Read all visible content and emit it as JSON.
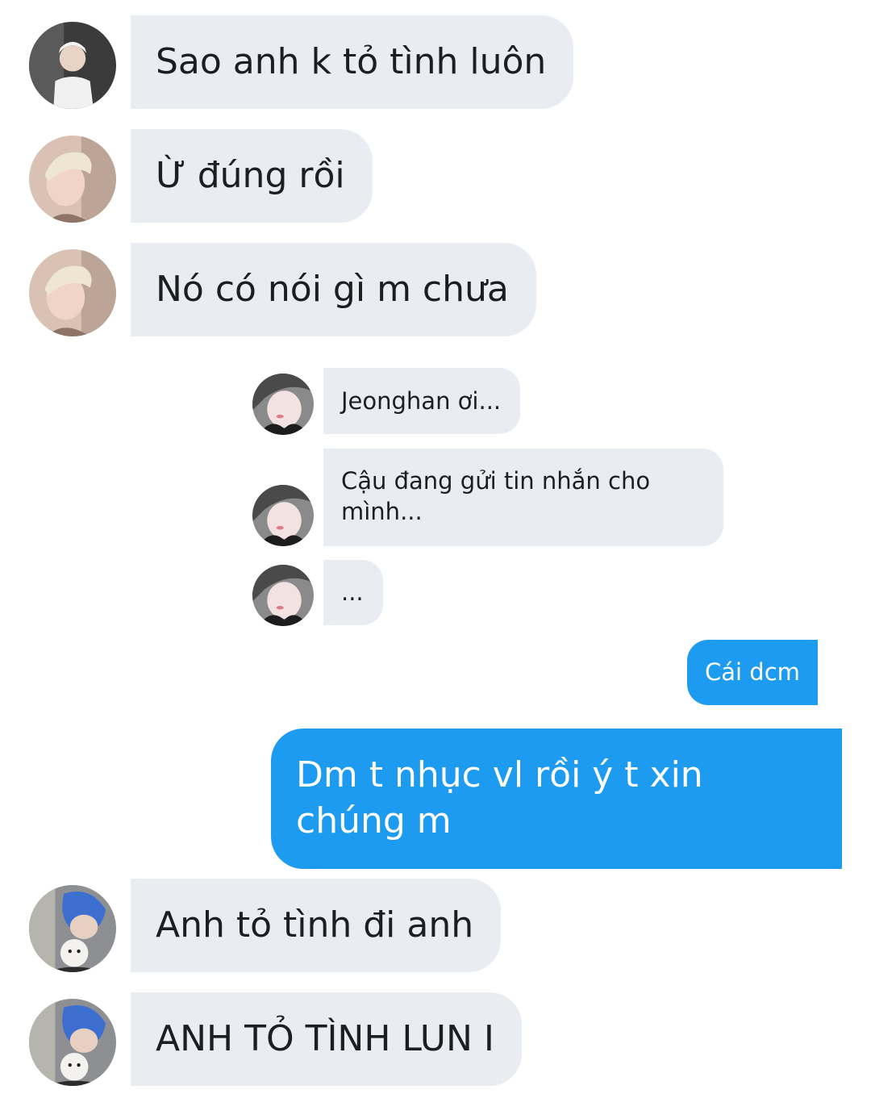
{
  "messages": [
    {
      "sender": "contact-1",
      "text": "Sao anh k tỏ tình luôn"
    },
    {
      "sender": "contact-2",
      "text": "Ừ đúng rồi"
    },
    {
      "sender": "contact-2",
      "text": "Nó có nói gì m chưa"
    },
    {
      "sender": "quoted-contact",
      "text": "Jeonghan ơi..."
    },
    {
      "sender": "quoted-contact",
      "text": "Cậu đang gửi tin nhắn cho mình..."
    },
    {
      "sender": "quoted-contact",
      "text": "..."
    },
    {
      "sender": "me",
      "text": "Cái dcm"
    },
    {
      "sender": "me",
      "text": "Dm t nhục vl rồi ý t xin chúng m"
    },
    {
      "sender": "contact-3",
      "text": "Anh tỏ tình đi anh"
    },
    {
      "sender": "contact-3",
      "text": "ANH TỎ TÌNH LUN I"
    }
  ],
  "colors": {
    "received_bubble": "#e9ecf1",
    "sent_bubble": "#1d9bf0",
    "received_text": "#1c1e21",
    "sent_text": "#ffffff"
  }
}
